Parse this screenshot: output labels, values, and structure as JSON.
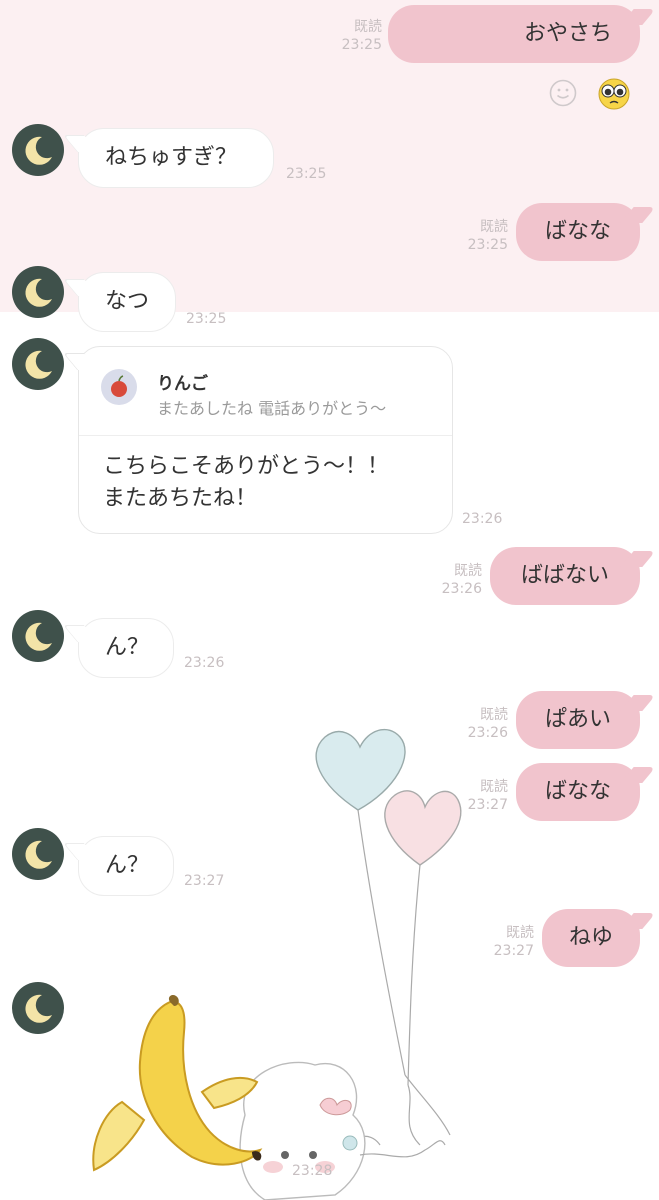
{
  "messages": {
    "m1": {
      "text": "おやさち",
      "read": "既読",
      "time": "23:25"
    },
    "m2": {
      "text": "ねちゅすぎ？",
      "time": "23:25"
    },
    "m3": {
      "text": "ばなな",
      "read": "既読",
      "time": "23:25"
    },
    "m4": {
      "text": "なつ",
      "time": "23:25"
    },
    "m5": {
      "quote_name": "りんご",
      "quote_text": "またあしたね 電話ありがとう〜",
      "line1": "こちらこそありがとう〜！！",
      "line2": "またあちたね！",
      "time": "23:26"
    },
    "m6": {
      "text": "ばばない",
      "read": "既読",
      "time": "23:26"
    },
    "m7": {
      "text": "ん？",
      "time": "23:26"
    },
    "m8": {
      "text": "ぱあい",
      "read": "既読",
      "time": "23:26"
    },
    "m9": {
      "text": "ばなな",
      "read": "既読",
      "time": "23:27"
    },
    "m10": {
      "text": "ん？",
      "time": "23:27"
    },
    "m11": {
      "text": "ねゆ",
      "read": "既読",
      "time": "23:27"
    },
    "m12": {
      "time": "23:28"
    }
  },
  "icons": {
    "avatar": "crescent-moon-icon",
    "reaction_add": "smiley-icon",
    "reaction": "pleading-face-emoji",
    "sticker": "banana-sticker",
    "background_art": "heart-balloons-illustration"
  },
  "colors": {
    "outgoing_bubble": "#f1c4cd",
    "top_background": "#fcf0f2",
    "avatar_bg": "#3f514b",
    "moon": "#f3e4a8",
    "timestamp": "#c7bfc1"
  }
}
